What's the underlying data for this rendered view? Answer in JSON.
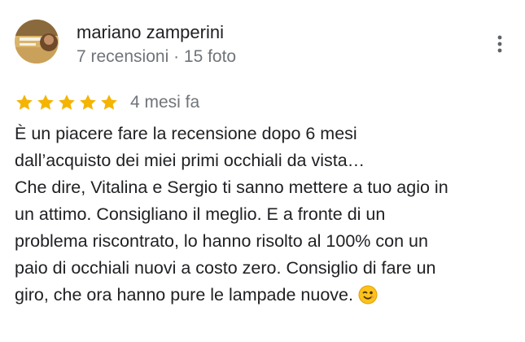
{
  "author": {
    "name": "mariano zamperini",
    "meta": "7 recensioni · 15 foto",
    "avatar_icon": "profile-photo"
  },
  "menu": {
    "icon": "more-vert-icon"
  },
  "rating": {
    "stars": 5,
    "max_stars": 5,
    "star_color": "#f4b400",
    "age": "4 mesi fa"
  },
  "review": {
    "lines": [
      "È un piacere fare la recensione dopo 6 mesi",
      "dall’acquisto dei miei primi occhiali da vista…",
      "Che dire, Vitalina e Sergio ti sanno mettere a tuo agio in",
      "un attimo. Consigliano il meglio. E a fronte di un",
      "problema riscontrato, lo hanno risolto al 100% con un",
      "paio di occhiali nuovi a costo zero. Consiglio di fare un",
      "giro, che ora hanno pure le lampade nuove."
    ],
    "trailing_emoji": "winking-face-emoji"
  }
}
